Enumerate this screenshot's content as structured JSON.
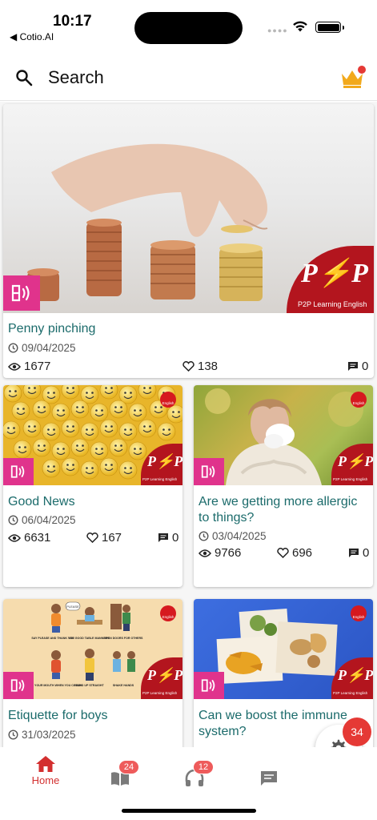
{
  "status_bar": {
    "time": "10:17",
    "back_app": "◀ Cotio.AI"
  },
  "header": {
    "search_label": "Search",
    "crown_color": "#f2a91c",
    "notification_dot_color": "#e53935"
  },
  "brand": {
    "logo_text": "P⚡P",
    "caption": "P2P Learning English",
    "mini_caption": "English",
    "accent": "#b3151e",
    "audio_badge_color": "#e0338c",
    "title_color": "#1b6b6b"
  },
  "articles": [
    {
      "title": "Penny pinching",
      "date": "09/04/2025",
      "views": "1677",
      "likes": "138",
      "comments": "0",
      "image": "hand-stacking-coins"
    },
    {
      "title": "Good News",
      "date": "06/04/2025",
      "views": "6631",
      "likes": "167",
      "comments": "0",
      "image": "smiley-balls"
    },
    {
      "title": "Are we getting more allergic to things?",
      "date": "03/04/2025",
      "views": "9766",
      "likes": "696",
      "comments": "0",
      "image": "woman-sneezing"
    },
    {
      "title": "Etiquette for boys",
      "date": "31/03/2025",
      "image": "etiquette-illustration",
      "illustration_labels": [
        "PLEASE",
        "SAY PLEASE AND THANK YOU",
        "USE GOOD TABLE MANNERS",
        "OPEN DOORS FOR OTHERS",
        "COVER YOUR MOUTH WHEN YOU COUGH",
        "STAND UP STRAIGHT",
        "SHAKE HANDS"
      ]
    },
    {
      "title": "Can we boost the immune system?",
      "date": "",
      "image": "turmeric-spices"
    }
  ],
  "bottom_nav": {
    "home_label": "Home",
    "reading_badge": "24",
    "listening_badge": "12"
  },
  "fab": {
    "badge": "34",
    "icon": "gear-icon"
  }
}
